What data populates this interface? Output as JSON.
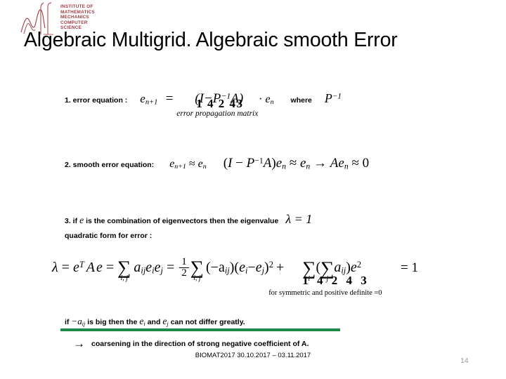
{
  "logo": {
    "alt": "institute-logo",
    "lines": [
      "INSTITUTE OF",
      "MATHEMATICS",
      "MECHANICS",
      "COMPUTER",
      "SCIENCE"
    ],
    "text_color": "#9e3b42"
  },
  "slide": {
    "title": "Algebraic Multigrid. Algebraic smooth Error",
    "page_number": "14",
    "footer": "BIOMAT2017   30.10.2017 – 03.11.2017",
    "accent_green": "#1f8a48"
  },
  "item1": {
    "label": "1. error equation :",
    "lhs": "e",
    "lhs_sub": "n+1",
    "equals": "=",
    "paren_open": "(",
    "matrix_I": "I",
    "minus": "−",
    "P": "P",
    "P_exp": "−1",
    "A": "A",
    "paren_close": ")",
    "dot": "·",
    "rhs_e": "e",
    "rhs_sub": "n",
    "underbrace_digits": "1 4 2 43",
    "underbrace_caption": "error propagation matrix",
    "where_label": "where",
    "where_P": "P",
    "where_P_exp": "−1"
  },
  "item2": {
    "label": "2. smooth error equation:",
    "eq_left": "e",
    "eq_left_sub": "n+1",
    "approx": "≈",
    "eq_right": "e",
    "eq_right_sub": "n",
    "full": "(I − P−1A)en ≈ en → Aen ≈ 0"
  },
  "item3": {
    "prefix": "3. if",
    "var_e": "e",
    "middle": "is the combination of eigenvectors then the eigenvalue",
    "eigen_lambda": "λ = 1",
    "second_line": "quadratic form for error :"
  },
  "formula": {
    "lambda": "λ",
    "eq1": "=",
    "eT": "e",
    "eT_sup": "T",
    "A": "A",
    "e": "e",
    "eq2": "=",
    "sum1_limits": "i, j",
    "a_ij": "a",
    "a_ij_sub": "ij",
    "e_i": "e",
    "e_i_sub": "i",
    "e_j": "e",
    "e_j_sub": "j",
    "eq3": "=",
    "frac_num": "1",
    "frac_den": "2",
    "sum2_limits": "i, j",
    "neg_a_ij": "(−a",
    "neg_a_ij_sub": "ij",
    "neg_a_close": ")",
    "sq_open": "(",
    "sq_minus": "−",
    "sq_close": ")",
    "sq_exp": "2",
    "plus": "+",
    "sum3_outer_limits": "i",
    "sum3_inner_limits": "j",
    "inner_a": "a",
    "inner_a_sub": "ij",
    "e_sq": "e",
    "e_sq_exp": "2",
    "underbrace_digits": "1 4 2 4 3",
    "underbrace_caption": "for symmetric and positive definite =0",
    "result": "= 1"
  },
  "conclusion": {
    "if_text": "if",
    "minus_a": "−a",
    "minus_a_sub": "ij",
    "mid_text": "is big then the",
    "e_i": "e",
    "e_i_sub": "i",
    "and_text": "and",
    "e_j": "e",
    "e_j_sub": "j",
    "end_text": "can not differ greatly.",
    "arrow": "→",
    "arrow_text": "coarsening in the direction of strong negative coefficient  of A."
  }
}
